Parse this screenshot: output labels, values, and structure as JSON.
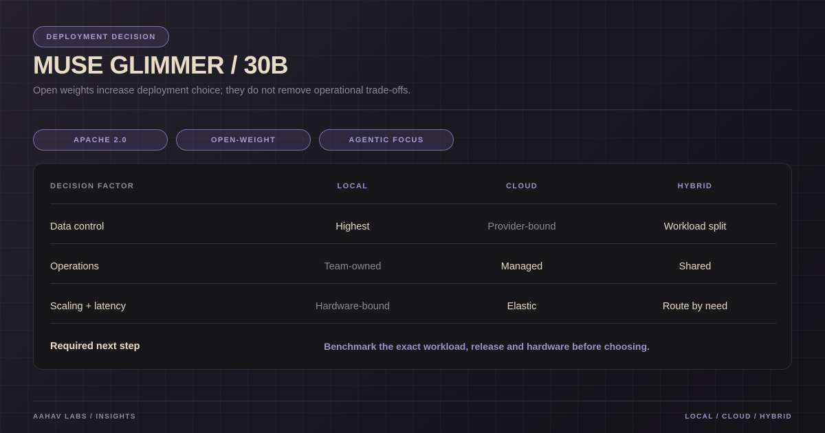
{
  "header": {
    "badge": "DEPLOYMENT DECISION",
    "title": "MUSE GLIMMER / 30B",
    "subtitle": "Open weights increase deployment choice; they do not remove operational trade-offs."
  },
  "tags": [
    "APACHE 2.0",
    "OPEN-WEIGHT",
    "AGENTIC FOCUS"
  ],
  "table": {
    "headers": {
      "factor": "DECISION FACTOR",
      "local": "LOCAL",
      "cloud": "CLOUD",
      "hybrid": "HYBRID"
    },
    "rows": [
      {
        "factor": "Data control",
        "local": "Highest",
        "cloud": "Provider-bound",
        "hybrid": "Workload split"
      },
      {
        "factor": "Operations",
        "local": "Team-owned",
        "cloud": "Managed",
        "hybrid": "Shared"
      },
      {
        "factor": "Scaling + latency",
        "local": "Hardware-bound",
        "cloud": "Elastic",
        "hybrid": "Route by need"
      }
    ],
    "next_step": {
      "label": "Required next step",
      "text": "Benchmark the exact workload, release and hardware before choosing."
    }
  },
  "footer": {
    "left": "AAHAV LABS / INSIGHTS",
    "right": "LOCAL / CLOUD / HYBRID"
  },
  "colors": {
    "accent": "#9e90c9",
    "title": "#e8dcc8",
    "background": "#1b1a21"
  }
}
